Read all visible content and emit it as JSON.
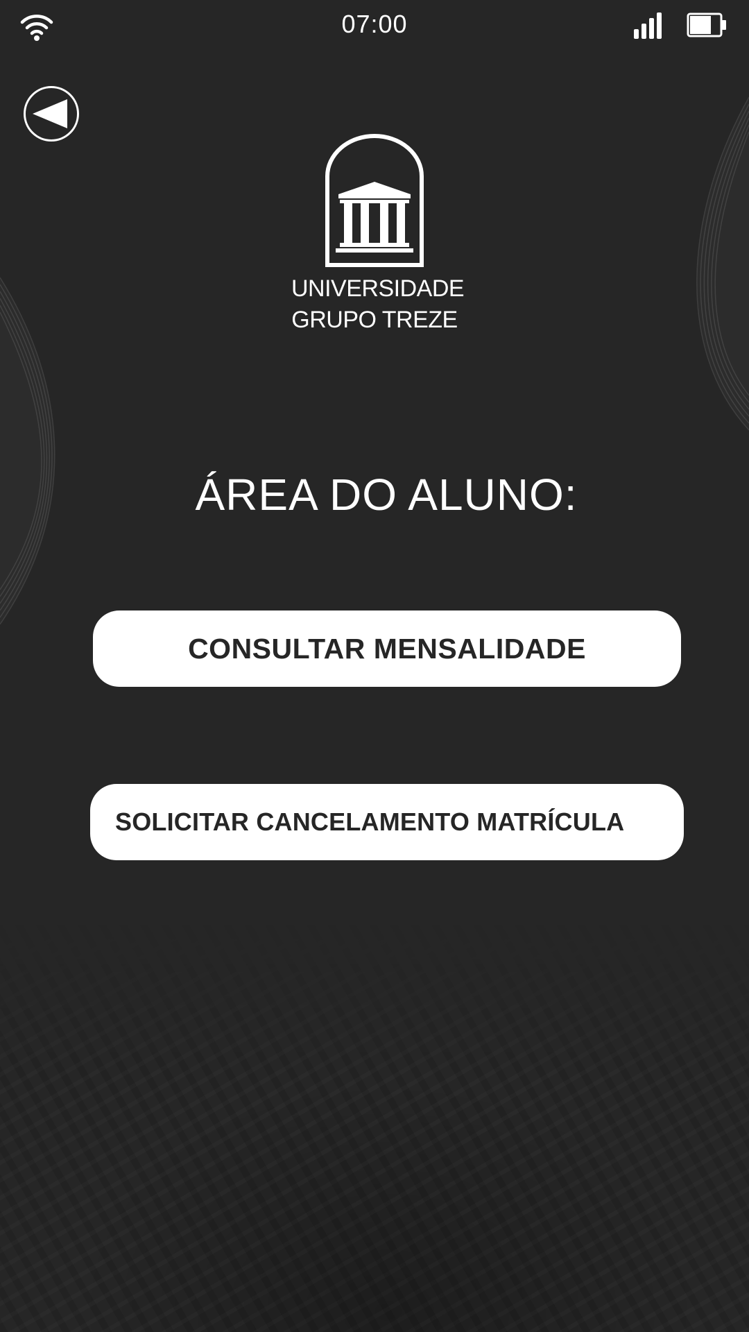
{
  "status_bar": {
    "time": "07:00",
    "icons": [
      "wifi-icon",
      "signal-icon",
      "battery-icon"
    ]
  },
  "nav": {
    "back_icon": "back-arrow-icon"
  },
  "logo": {
    "line1": "UNIVERSIDADE",
    "line2": "GRUPO TREZE",
    "icon": "university-building-icon"
  },
  "main": {
    "heading": "ÁREA DO ALUNO:",
    "buttons": [
      {
        "label": "CONSULTAR MENSALIDADE"
      },
      {
        "label": "SOLICITAR CANCELAMENTO MATRÍCULA"
      }
    ]
  },
  "colors": {
    "background": "#262626",
    "foreground": "#ffffff",
    "button_text": "#262626"
  }
}
